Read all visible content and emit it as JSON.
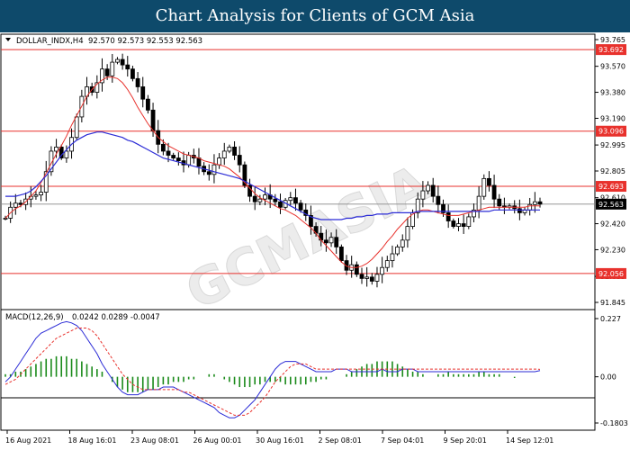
{
  "header": {
    "title": "Chart Analysis for Clients of GCM Asia"
  },
  "chart_data": {
    "type": "candlestick",
    "instrument": "DOLLAR_INDX,H4",
    "ohlc_text": "92.570 92.573 92.553 92.563",
    "last_price": 92.563,
    "watermark": "GCMASIA",
    "main_price_labels": [
      "93.765",
      "93.570",
      "93.380",
      "93.190",
      "92.995",
      "92.805",
      "92.610",
      "92.420",
      "92.230",
      "92.035",
      "91.845"
    ],
    "main_ylim": [
      91.845,
      93.765
    ],
    "horizontal_levels": [
      {
        "value": 93.692,
        "label": "93.692",
        "color": "#e8312c"
      },
      {
        "value": 93.096,
        "label": "93.096",
        "color": "#e8312c"
      },
      {
        "value": 92.693,
        "label": "92.693",
        "color": "#e8312c"
      },
      {
        "value": 92.056,
        "label": "92.056",
        "color": "#e8312c"
      }
    ],
    "x_labels": [
      "16 Aug 2021",
      "18 Aug 16:01",
      "23 Aug 08:01",
      "26 Aug 00:01",
      "30 Aug 16:01",
      "2 Sep 08:01",
      "7 Sep 04:01",
      "9 Sep 20:01",
      "14 Sep 12:01"
    ],
    "candles_close": [
      92.46,
      92.54,
      92.57,
      92.56,
      92.6,
      92.62,
      92.63,
      92.65,
      92.8,
      92.95,
      92.98,
      92.9,
      92.95,
      93.05,
      93.2,
      93.35,
      93.42,
      93.38,
      93.45,
      93.55,
      93.5,
      93.6,
      93.62,
      93.58,
      93.55,
      93.48,
      93.42,
      93.33,
      93.25,
      93.1,
      93.0,
      92.95,
      92.92,
      92.9,
      92.88,
      92.85,
      92.92,
      92.9,
      92.84,
      92.8,
      92.78,
      92.85,
      92.9,
      92.95,
      92.98,
      92.92,
      92.85,
      92.7,
      92.62,
      92.58,
      92.6,
      92.63,
      92.6,
      92.58,
      92.54,
      92.59,
      92.61,
      92.57,
      92.52,
      92.48,
      92.4,
      92.35,
      92.3,
      92.28,
      92.32,
      92.25,
      92.15,
      92.08,
      92.12,
      92.05,
      92.02,
      92.03,
      92.0,
      92.05,
      92.1,
      92.15,
      92.2,
      92.25,
      92.3,
      92.4,
      92.5,
      92.6,
      92.66,
      92.7,
      92.62,
      92.56,
      92.5,
      92.44,
      92.4,
      92.42,
      92.4,
      92.47,
      92.52,
      92.62,
      92.75,
      92.7,
      92.6,
      92.55,
      92.54,
      92.55,
      92.53,
      92.5,
      92.52,
      92.56,
      92.58,
      92.563
    ],
    "ma_fast": [
      92.46,
      92.5,
      92.53,
      92.55,
      92.58,
      92.62,
      92.66,
      92.72,
      92.79,
      92.86,
      92.93,
      92.99,
      93.06,
      93.14,
      93.21,
      93.28,
      93.35,
      93.4,
      93.44,
      93.47,
      93.49,
      93.49,
      93.48,
      93.45,
      93.4,
      93.34,
      93.27,
      93.21,
      93.15,
      93.1,
      93.05,
      93.02,
      92.99,
      92.97,
      92.95,
      92.93,
      92.92,
      92.91,
      92.9,
      92.88,
      92.87,
      92.86,
      92.85,
      92.84,
      92.82,
      92.79,
      92.76,
      92.72,
      92.68,
      92.64,
      92.61,
      92.59,
      92.57,
      92.55,
      92.53,
      92.52,
      92.5,
      92.48,
      92.45,
      92.42,
      92.39,
      92.35,
      92.3,
      92.26,
      92.22,
      92.18,
      92.14,
      92.11,
      92.1,
      92.1,
      92.11,
      92.13,
      92.16,
      92.2,
      92.24,
      92.29,
      92.33,
      92.38,
      92.42,
      92.46,
      92.49,
      92.51,
      92.52,
      92.52,
      92.51,
      92.5,
      92.49,
      92.48,
      92.48,
      92.48,
      92.49,
      92.5,
      92.51,
      92.52,
      92.53,
      92.54,
      92.54,
      92.54,
      92.54,
      92.54,
      92.54,
      92.54,
      92.54,
      92.55,
      92.55,
      92.55
    ],
    "ma_slow": [
      92.62,
      92.62,
      92.62,
      92.63,
      92.64,
      92.66,
      92.69,
      92.73,
      92.77,
      92.82,
      92.87,
      92.92,
      92.96,
      93.0,
      93.03,
      93.05,
      93.07,
      93.08,
      93.09,
      93.09,
      93.08,
      93.07,
      93.06,
      93.05,
      93.03,
      93.02,
      93.0,
      92.98,
      92.96,
      92.94,
      92.92,
      92.9,
      92.89,
      92.88,
      92.87,
      92.86,
      92.85,
      92.84,
      92.83,
      92.82,
      92.81,
      92.8,
      92.79,
      92.78,
      92.77,
      92.76,
      92.75,
      92.73,
      92.71,
      92.69,
      92.67,
      92.65,
      92.63,
      92.61,
      92.59,
      92.57,
      92.55,
      92.53,
      92.51,
      92.49,
      92.47,
      92.46,
      92.45,
      92.45,
      92.45,
      92.45,
      92.45,
      92.46,
      92.46,
      92.47,
      92.47,
      92.48,
      92.48,
      92.49,
      92.49,
      92.49,
      92.5,
      92.5,
      92.5,
      92.5,
      92.5,
      92.51,
      92.51,
      92.51,
      92.51,
      92.51,
      92.51,
      92.51,
      92.51,
      92.51,
      92.51,
      92.51,
      92.51,
      92.51,
      92.51,
      92.51,
      92.52,
      92.52,
      92.52,
      92.52,
      92.52,
      92.52,
      92.52,
      92.52,
      92.52,
      92.52
    ],
    "macd": {
      "label": "MACD(12,26,9)",
      "values_text": "0.0242 0.0289 -0.0047",
      "price_labels": [
        "0.227",
        "0.00",
        "-0.1803"
      ],
      "ylim": [
        -0.1803,
        0.227
      ],
      "histogram": [
        0.01,
        0.01,
        0.02,
        0.02,
        0.03,
        0.04,
        0.05,
        0.06,
        0.07,
        0.07,
        0.08,
        0.08,
        0.08,
        0.07,
        0.07,
        0.06,
        0.05,
        0.04,
        0.03,
        0.02,
        0.0,
        -0.02,
        -0.04,
        -0.05,
        -0.06,
        -0.06,
        -0.06,
        -0.06,
        -0.05,
        -0.05,
        -0.04,
        -0.03,
        -0.03,
        -0.02,
        -0.02,
        -0.02,
        -0.01,
        -0.01,
        0.0,
        0.0,
        0.01,
        0.01,
        0.0,
        -0.01,
        -0.02,
        -0.03,
        -0.04,
        -0.04,
        -0.04,
        -0.03,
        -0.03,
        -0.02,
        -0.02,
        -0.02,
        -0.02,
        -0.03,
        -0.03,
        -0.03,
        -0.03,
        -0.03,
        -0.02,
        -0.02,
        -0.01,
        -0.01,
        0.0,
        0.0,
        0.0,
        0.01,
        0.02,
        0.03,
        0.04,
        0.05,
        0.05,
        0.06,
        0.06,
        0.06,
        0.06,
        0.05,
        0.04,
        0.03,
        0.02,
        0.02,
        0.01,
        0.0,
        0.0,
        0.01,
        0.01,
        0.02,
        0.01,
        0.01,
        0.01,
        0.01,
        0.01,
        0.02,
        0.02,
        0.01,
        0.01,
        0.01,
        0.0,
        0.0,
        -0.0047
      ],
      "main_line": [
        -0.02,
        0.0,
        0.03,
        0.06,
        0.09,
        0.12,
        0.15,
        0.17,
        0.18,
        0.19,
        0.2,
        0.21,
        0.215,
        0.21,
        0.2,
        0.18,
        0.15,
        0.12,
        0.09,
        0.05,
        0.02,
        -0.01,
        -0.04,
        -0.06,
        -0.07,
        -0.07,
        -0.07,
        -0.06,
        -0.05,
        -0.05,
        -0.05,
        -0.04,
        -0.04,
        -0.04,
        -0.05,
        -0.06,
        -0.07,
        -0.08,
        -0.09,
        -0.1,
        -0.11,
        -0.12,
        -0.14,
        -0.15,
        -0.16,
        -0.16,
        -0.15,
        -0.13,
        -0.11,
        -0.09,
        -0.06,
        -0.03,
        0.0,
        0.03,
        0.05,
        0.06,
        0.06,
        0.06,
        0.05,
        0.04,
        0.03,
        0.02,
        0.02,
        0.02,
        0.02,
        0.03,
        0.03,
        0.03,
        0.02,
        0.02,
        0.02,
        0.02,
        0.02,
        0.02,
        0.03,
        0.02,
        0.02,
        0.02,
        0.03,
        0.03,
        0.03,
        0.02,
        0.02,
        0.02,
        0.02,
        0.02,
        0.02,
        0.02,
        0.02,
        0.02,
        0.02,
        0.02,
        0.02,
        0.02,
        0.02,
        0.02,
        0.02,
        0.02,
        0.02,
        0.02,
        0.02,
        0.02,
        0.02,
        0.02,
        0.02,
        0.0242
      ],
      "signal_line": [
        -0.03,
        -0.02,
        -0.01,
        0.01,
        0.03,
        0.05,
        0.07,
        0.09,
        0.11,
        0.13,
        0.15,
        0.16,
        0.17,
        0.18,
        0.19,
        0.19,
        0.19,
        0.18,
        0.16,
        0.13,
        0.1,
        0.07,
        0.04,
        0.01,
        -0.01,
        -0.03,
        -0.04,
        -0.05,
        -0.05,
        -0.05,
        -0.05,
        -0.05,
        -0.05,
        -0.05,
        -0.05,
        -0.06,
        -0.06,
        -0.07,
        -0.08,
        -0.09,
        -0.1,
        -0.11,
        -0.12,
        -0.13,
        -0.14,
        -0.15,
        -0.15,
        -0.15,
        -0.14,
        -0.12,
        -0.1,
        -0.08,
        -0.05,
        -0.02,
        0.0,
        0.02,
        0.04,
        0.05,
        0.05,
        0.05,
        0.04,
        0.03,
        0.03,
        0.03,
        0.03,
        0.03,
        0.03,
        0.03,
        0.03,
        0.03,
        0.03,
        0.03,
        0.03,
        0.03,
        0.03,
        0.03,
        0.03,
        0.03,
        0.03,
        0.03,
        0.03,
        0.03,
        0.03,
        0.03,
        0.03,
        0.03,
        0.03,
        0.03,
        0.03,
        0.03,
        0.03,
        0.03,
        0.03,
        0.03,
        0.03,
        0.03,
        0.03,
        0.03,
        0.03,
        0.03,
        0.03,
        0.03,
        0.03,
        0.03,
        0.03,
        0.0289
      ]
    },
    "colors": {
      "level_line": "#e8312c",
      "ma_fast": "#e8312c",
      "ma_slow": "#2b2bd6",
      "candle_up": "#ffffff",
      "candle_down": "#000000",
      "macd_hist": "#1a8a1a",
      "macd_main": "#2b2bd6",
      "macd_signal": "#e8312c",
      "current_price_bg": "#000000"
    }
  }
}
